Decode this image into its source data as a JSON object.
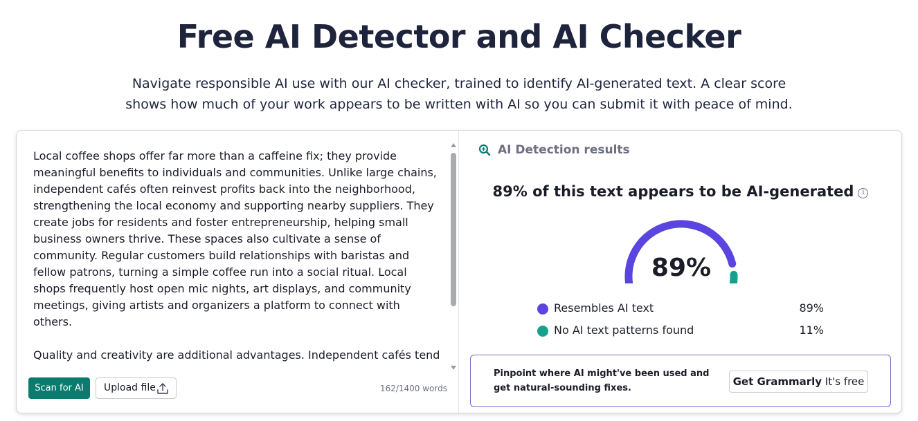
{
  "hero": {
    "title": "Free AI Detector and AI Checker",
    "subtitle_line1": "Navigate responsible AI use with our AI checker, trained to identify AI-generated text. A clear score",
    "subtitle_line2": "shows how much of your work appears to be written with AI so you can submit it with peace of mind."
  },
  "editor": {
    "paragraph1": "Local coffee shops offer far more than a caffeine fix; they provide meaningful benefits to individuals and communities. Unlike large chains, independent cafés often reinvest profits back into the neighborhood, strengthening the local economy and supporting nearby suppliers. They create jobs for residents and foster entrepreneurship, helping small business owners thrive. These spaces also cultivate a sense of community. Regular customers build relationships with baristas and fellow patrons, turning a simple coffee run into a social ritual. Local shops frequently host open mic nights, art displays, and community meetings, giving artists and organizers a platform to connect with others.",
    "paragraph2": "Quality and creativity are additional advantages. Independent cafés tend to experiment with unique roasting styles, seasonal drinks, and locally sourced ingredients, offering distinctive flavors you won't find elsewhere. Their cozy",
    "scan_button": "Scan for AI",
    "upload_button": "Upload file",
    "word_count": "162/1400 words"
  },
  "results": {
    "title": "AI Detection results",
    "headline": "89% of this text appears to be AI-generated",
    "info_glyph": "i",
    "gauge_value": "89%",
    "gauge_fraction": 0.89,
    "legend": [
      {
        "label": "Resembles AI text",
        "percent": "89%",
        "color": "#5b45e0"
      },
      {
        "label": "No AI text patterns found",
        "percent": "11%",
        "color": "#14a28f"
      }
    ]
  },
  "promo": {
    "text": "Pinpoint where AI might've been used and get natural-sounding fixes.",
    "button_strong": "Get Grammarly",
    "button_rest": " It's free"
  },
  "colors": {
    "brand_green": "#0a7b6e",
    "ai_purple": "#5b45e0",
    "human_teal": "#14a28f",
    "promo_border": "#7b66c8"
  },
  "icons": [
    "search-magnifier-icon",
    "info-icon",
    "upload-icon",
    "scroll-up-icon",
    "scroll-down-icon"
  ]
}
